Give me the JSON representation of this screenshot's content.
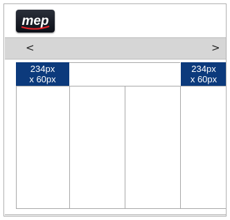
{
  "logo": {
    "text": "mep"
  },
  "nav": {
    "prev": "<",
    "next": ">"
  },
  "ads": {
    "left": {
      "line1": "234px",
      "line2": "x 60px"
    },
    "right": {
      "line1": "234px",
      "line2": "x 60px"
    }
  }
}
